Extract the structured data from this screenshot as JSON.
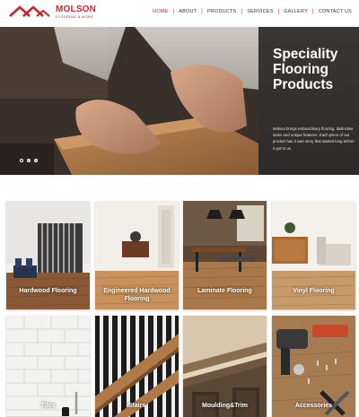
{
  "brand": {
    "name": "MOLSON",
    "tagline": "FLOORING & MORE",
    "color": "#d0232b"
  },
  "nav": {
    "items": [
      {
        "label": "HOME",
        "active": true
      },
      {
        "label": "ABOUT",
        "active": false
      },
      {
        "label": "PRODUCTS",
        "active": false
      },
      {
        "label": "SERVICES",
        "active": false
      },
      {
        "label": "GALLERY",
        "active": false
      },
      {
        "label": "CONTACT US",
        "active": false
      }
    ],
    "separator": "|"
  },
  "hero": {
    "title": "Speciality Flooring Products",
    "text": "Molson brings extraordinary flooring, distinctive stairs and unique features. Each piece of our product has it own story that started long before it got to us.",
    "slides": 3,
    "active_slide": 1
  },
  "products": [
    {
      "label": "Hardwood Flooring",
      "icon": "hardwood-floor-photo"
    },
    {
      "label": "Engineered Hardwood Flooring",
      "icon": "engineered-floor-photo"
    },
    {
      "label": "Laminate Flooring",
      "icon": "laminate-floor-photo"
    },
    {
      "label": "Vinyl Flooring",
      "icon": "vinyl-floor-photo"
    },
    {
      "label": "Tiles",
      "icon": "tiles-photo"
    },
    {
      "label": "Stairs",
      "icon": "stairs-photo"
    },
    {
      "label": "Moulding&Trim",
      "icon": "moulding-photo"
    },
    {
      "label": "Accessories",
      "icon": "accessories-photo"
    }
  ]
}
